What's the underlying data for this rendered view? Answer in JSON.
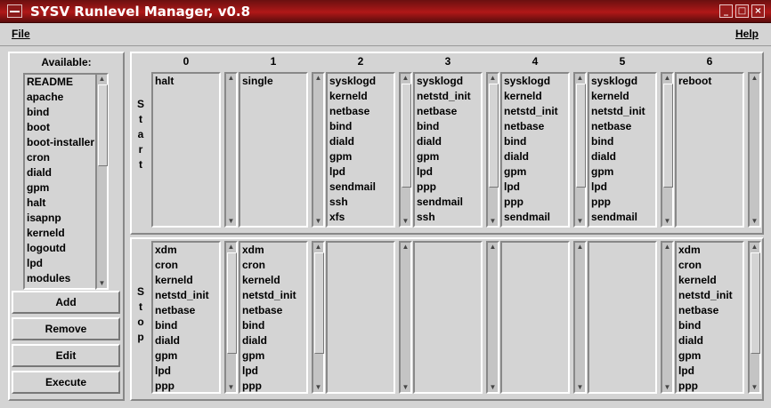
{
  "window": {
    "title": "SYSV Runlevel Manager, v0.8"
  },
  "menu": {
    "file": "File",
    "help": "Help"
  },
  "available": {
    "label": "Available:",
    "items": [
      "README",
      "apache",
      "bind",
      "boot",
      "boot-installer",
      "cron",
      "diald",
      "gpm",
      "halt",
      "isapnp",
      "kerneld",
      "logoutd",
      "lpd",
      "modules"
    ]
  },
  "buttons": {
    "add": "Add",
    "remove": "Remove",
    "edit": "Edit",
    "execute": "Execute"
  },
  "start": {
    "label": [
      "S",
      "t",
      "a",
      "r",
      "t"
    ]
  },
  "stop": {
    "label": [
      "S",
      "t",
      "o",
      "p"
    ]
  },
  "runlevels": [
    {
      "name": "0",
      "start": [
        "halt"
      ],
      "stop": [
        "xdm",
        "cron",
        "kerneld",
        "netstd_init",
        "netbase",
        "bind",
        "diald",
        "gpm",
        "lpd",
        "ppp"
      ]
    },
    {
      "name": "1",
      "start": [
        "single"
      ],
      "stop": [
        "xdm",
        "cron",
        "kerneld",
        "netstd_init",
        "netbase",
        "bind",
        "diald",
        "gpm",
        "lpd",
        "ppp"
      ]
    },
    {
      "name": "2",
      "start": [
        "sysklogd",
        "kerneld",
        "netbase",
        "bind",
        "diald",
        "gpm",
        "lpd",
        "sendmail",
        "ssh",
        "xfs"
      ],
      "stop": []
    },
    {
      "name": "3",
      "start": [
        "sysklogd",
        "netstd_init",
        "netbase",
        "bind",
        "diald",
        "gpm",
        "lpd",
        "ppp",
        "sendmail",
        "ssh"
      ],
      "stop": []
    },
    {
      "name": "4",
      "start": [
        "sysklogd",
        "kerneld",
        "netstd_init",
        "netbase",
        "bind",
        "diald",
        "gpm",
        "lpd",
        "ppp",
        "sendmail"
      ],
      "stop": []
    },
    {
      "name": "5",
      "start": [
        "sysklogd",
        "kerneld",
        "netstd_init",
        "netbase",
        "bind",
        "diald",
        "gpm",
        "lpd",
        "ppp",
        "sendmail"
      ],
      "stop": []
    },
    {
      "name": "6",
      "start": [
        "reboot"
      ],
      "stop": [
        "xdm",
        "cron",
        "kerneld",
        "netstd_init",
        "netbase",
        "bind",
        "diald",
        "gpm",
        "lpd",
        "ppp"
      ]
    }
  ],
  "colors": {
    "titlebar": "#b01818",
    "background": "#d4d4d4"
  },
  "icons": {
    "window": "window-menu-icon",
    "minimize": "minimize-icon",
    "maximize": "maximize-icon",
    "close": "close-icon"
  }
}
